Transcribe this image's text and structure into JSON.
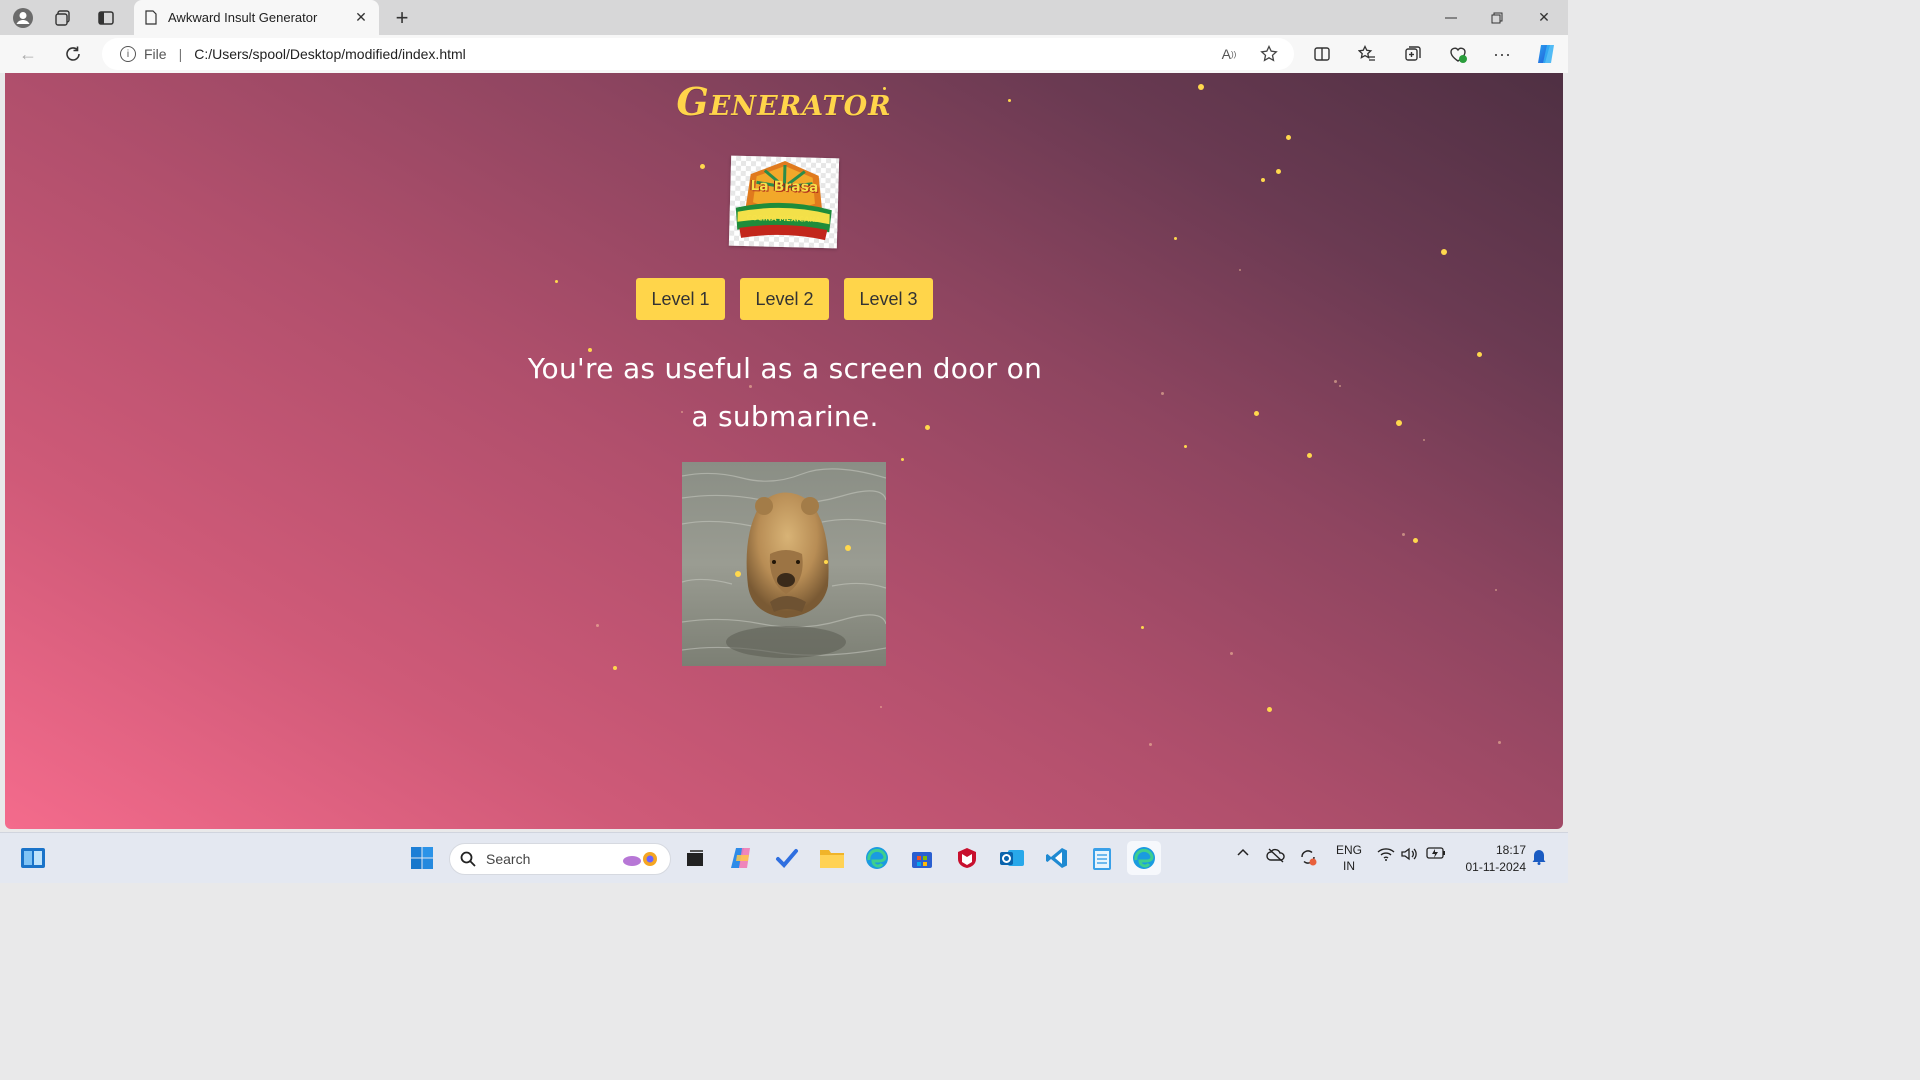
{
  "browser": {
    "tab_title": "Awkward Insult Generator",
    "address_prefix": "File",
    "address_url": "C:/Users/spool/Desktop/modified/index.html"
  },
  "page": {
    "title": "Generator",
    "logo_text": "La Brasa",
    "logo_band": "COCINA MEXICANA",
    "levels": [
      "Level 1",
      "Level 2",
      "Level 3"
    ],
    "insult": "You're as useful as a screen door on a submarine.",
    "colors": {
      "accent_yellow": "#ffd54a",
      "gradient_start": "#f46b8c",
      "gradient_end": "#4f3043"
    }
  },
  "taskbar": {
    "search_placeholder": "Search",
    "language": "ENG",
    "region": "IN",
    "time": "18:17",
    "date": "01-11-2024",
    "apps": [
      "start-icon",
      "search-icon",
      "task-view-icon",
      "copilot-icon",
      "todo-icon",
      "file-explorer-icon",
      "edge-icon",
      "store-icon",
      "mcafee-icon",
      "outlook-icon",
      "vscode-icon",
      "notepad-icon",
      "edge-active-icon"
    ]
  }
}
